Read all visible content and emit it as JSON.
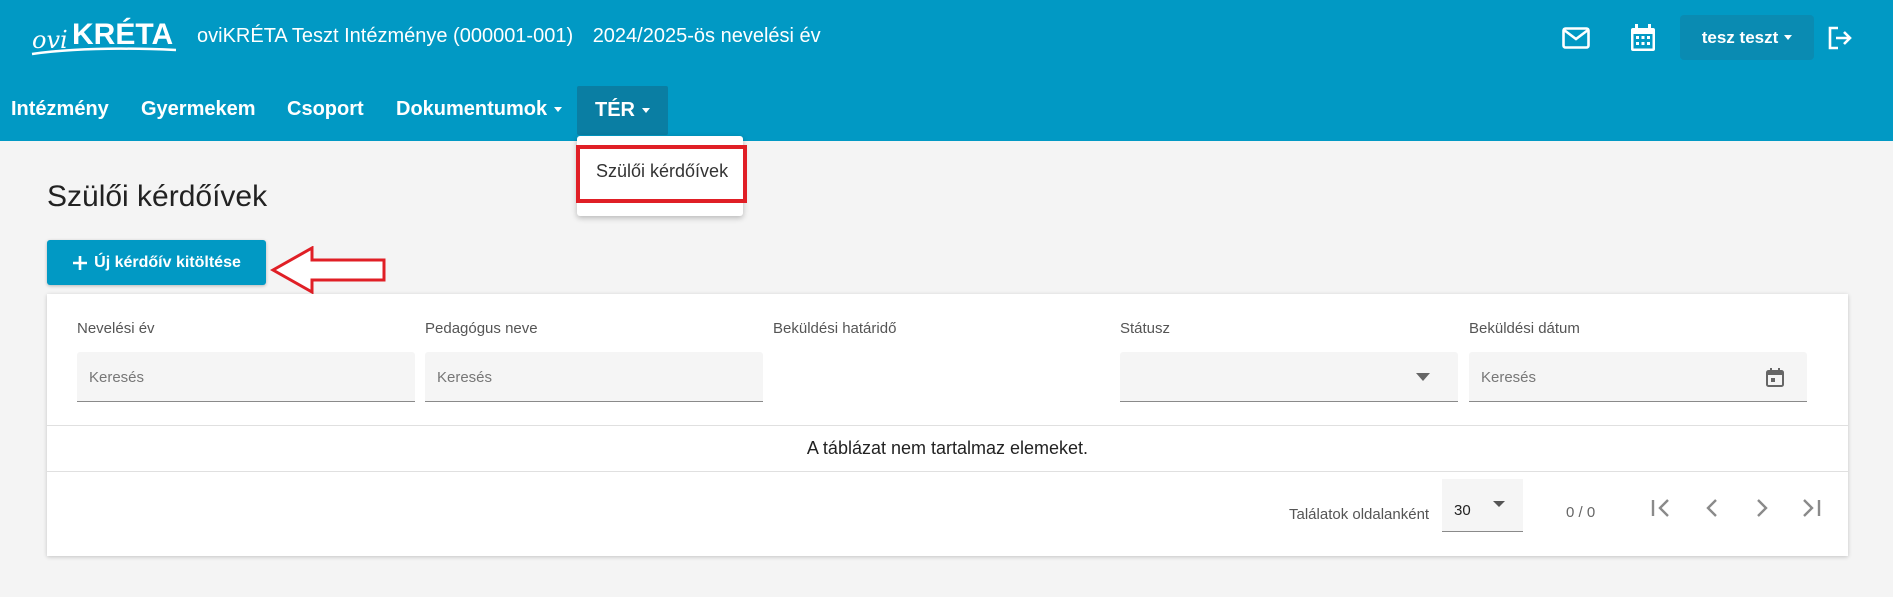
{
  "header": {
    "logo_text": "oviKRÉTA",
    "institution": "oviKRÉTA Teszt Intézménye (000001-001)",
    "school_year": "2024/2025-ös nevelési év",
    "user_name": "tesz teszt",
    "icons": [
      "mail-icon",
      "calendar-icon",
      "logout-icon"
    ]
  },
  "nav": {
    "items": [
      {
        "label": "Intézmény"
      },
      {
        "label": "Gyermekem"
      },
      {
        "label": "Csoport"
      },
      {
        "label": "Dokumentumok"
      },
      {
        "label": "TÉR"
      }
    ],
    "active": "TÉR",
    "dropdown": {
      "items": [
        {
          "label": "Szülői kérdőívek"
        }
      ]
    }
  },
  "page": {
    "title": "Szülői kérdőívek",
    "new_button_label": "Új kérdőív kitöltése"
  },
  "table": {
    "columns": [
      {
        "label": "Nevelési év",
        "filter": "text",
        "placeholder": "Keresés"
      },
      {
        "label": "Pedagógus neve",
        "filter": "text",
        "placeholder": "Keresés"
      },
      {
        "label": "Beküldési határidő",
        "filter": "none"
      },
      {
        "label": "Státusz",
        "filter": "select",
        "value": ""
      },
      {
        "label": "Beküldési dátum",
        "filter": "date",
        "placeholder": "Keresés"
      }
    ],
    "empty_message": "A táblázat nem tartalmaz elemeket.",
    "pagination": {
      "per_page_label": "Találatok oldalanként",
      "per_page_value": "30",
      "range_text": "0 / 0"
    }
  },
  "colors": {
    "brand": "#0199c4",
    "nav_active": "#0a7ea3",
    "annotation_red": "#e01f26"
  }
}
